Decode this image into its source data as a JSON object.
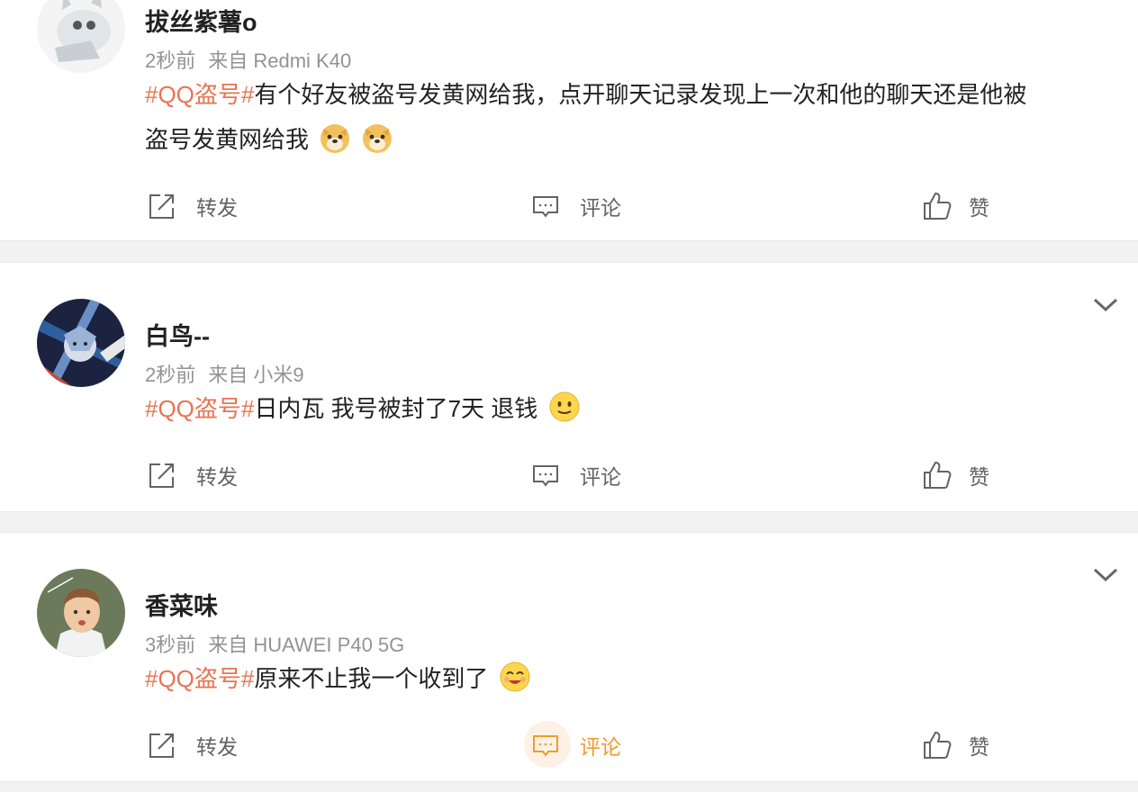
{
  "posts": [
    {
      "username": "拔丝紫薯o",
      "time": "2秒前",
      "source": "来自 Redmi K40",
      "topic": "#QQ盗号#",
      "text_line1": "有个好友被盗号发黄网给我，点开聊天记录发现上一次和他的聊天还是他被",
      "text_line2": "盗号发黄网给我",
      "emojis": [
        "doge-emoji",
        "doge-emoji"
      ],
      "actions": {
        "forward": "转发",
        "comment": "评论",
        "like": "赞"
      }
    },
    {
      "username": "白鸟--",
      "time": "2秒前",
      "source": "来自 小米9",
      "topic": "#QQ盗号#",
      "text": "日内瓦 我号被封了7天 退钱",
      "emojis": [
        "smile-emoji"
      ],
      "actions": {
        "forward": "转发",
        "comment": "评论",
        "like": "赞"
      }
    },
    {
      "username": "香菜味",
      "time": "3秒前",
      "source": "来自 HUAWEI P40 5G",
      "topic": "#QQ盗号#",
      "text": "原来不止我一个收到了",
      "emojis": [
        "happy-emoji"
      ],
      "actions": {
        "forward": "转发",
        "comment": "评论",
        "like": "赞"
      },
      "active_action": "comment"
    }
  ],
  "colors": {
    "topic": "#eb7350",
    "active_action": "#f29a2e",
    "background": "#f2f2f2"
  }
}
